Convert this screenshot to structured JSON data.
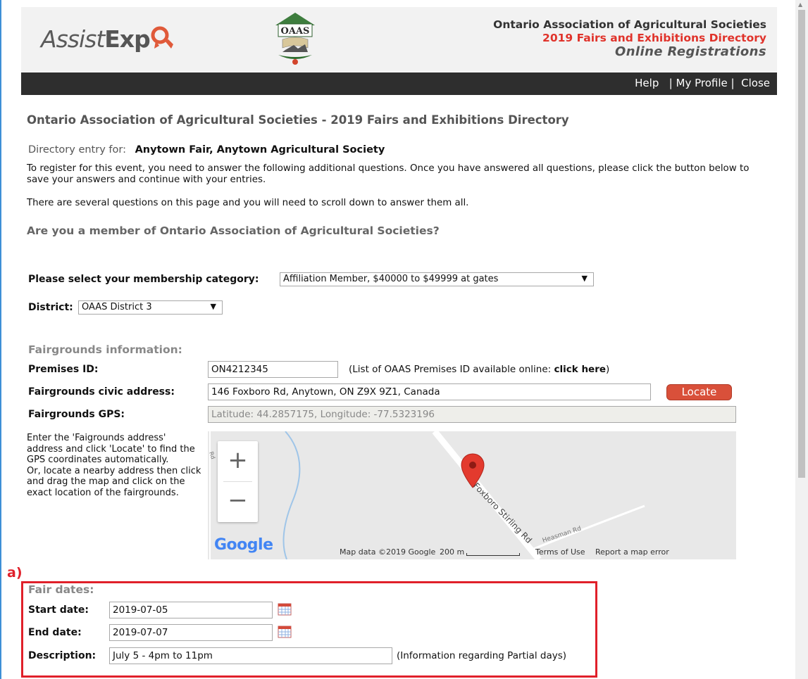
{
  "header": {
    "logo_text_1": "Assist",
    "logo_text_2": "Exp",
    "oaas_logo_text": "OAAS",
    "org_name": "Ontario Association of Agricultural Societies",
    "directory": "2019 Fairs and Exhibitions Directory",
    "subtitle": "Online Registrations"
  },
  "nav": {
    "help": "Help",
    "sep1": "|",
    "profile": "My Profile",
    "sep2": "|",
    "close": "Close"
  },
  "page": {
    "title": "Ontario Association of Agricultural Societies - 2019 Fairs and Exhibitions Directory",
    "entry_label": "Directory entry for:",
    "entry_value": "Anytown Fair, Anytown Agricultural Society",
    "intro_1": "To register for this event, you need to answer the following additional questions. Once you have answered all questions, please click the button below to save your answers and continue with your entries.",
    "intro_2": "There are several questions on this page and you will need to scroll down to answer them all.",
    "member_question": "Are you a member of Ontario Association of Agricultural Societies?"
  },
  "membership": {
    "label": "Please select your membership category:",
    "selected": "Affiliation Member, $40000 to $49999 at gates",
    "arrow": "▼"
  },
  "district": {
    "label": "District:",
    "selected": "OAAS District 3",
    "arrow": "▼"
  },
  "fairgrounds": {
    "section": "Fairgrounds information:",
    "premises_label": "Premises ID:",
    "premises_value": "ON4212345",
    "premises_note_prefix": "(List of OAAS Premises ID available online: ",
    "premises_note_link": "click here",
    "premises_note_suffix": ")",
    "address_label": "Fairgrounds civic address:",
    "address_value": "146 Foxboro Rd, Anytown, ON Z9X 9Z1, Canada",
    "locate_button": "Locate",
    "gps_label": "Fairgrounds GPS:",
    "gps_value": "Latitude: 44.2857175, Longitude: -77.5323196",
    "map_help": "Enter the 'Faigrounds address' address and click 'Locate' to find the GPS coordinates automatically.",
    "map_help_2": "Or, locate a nearby address then click and drag the map and click on the exact location of the fairgrounds."
  },
  "map": {
    "zoom_in": "+",
    "zoom_out": "−",
    "road_1": "Foxboro Stirling Rd",
    "road_2": "Heasman Rd",
    "road_3": "Rd",
    "google": "Google",
    "attribution": "Map data ©2019 Google",
    "scale": "200 m",
    "terms": "Terms of Use",
    "report": "Report a map error"
  },
  "annotation": {
    "label": "a)"
  },
  "fair_dates": {
    "section": "Fair dates:",
    "start_label": "Start date:",
    "start_value": "2019-07-05",
    "end_label": "End date:",
    "end_value": "2019-07-07",
    "desc_label": "Description:",
    "desc_value": "July 5 - 4pm to 11pm",
    "desc_note": "(Information regarding Partial days)"
  },
  "colors": {
    "accent_red": "#e0332b",
    "nav_bg": "#2e2e2e",
    "locate_btn": "#d9503a",
    "highlight_box": "#e0202a"
  }
}
